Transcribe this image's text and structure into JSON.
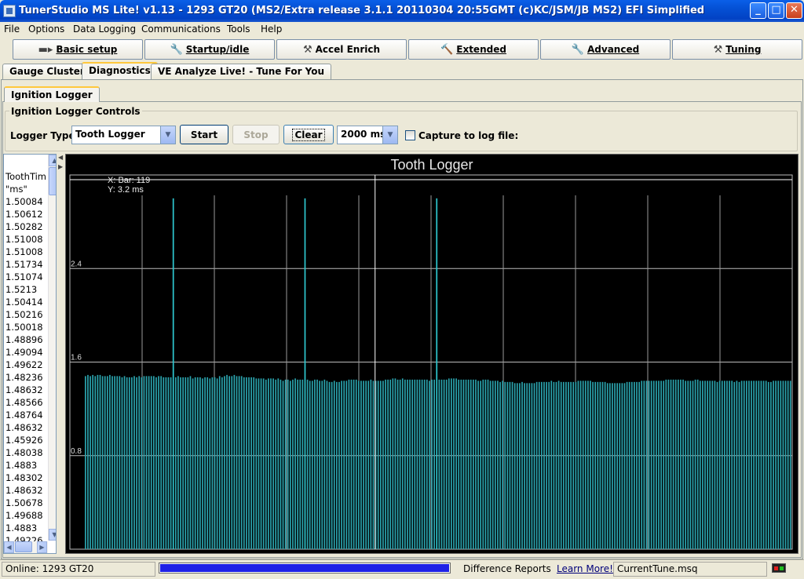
{
  "window": {
    "title": "TunerStudio MS Lite! v1.13 - 1293 GT20 (MS2/Extra release 3.1.1 20110304 20:55GMT (c)KC/JSM/JB MS2) EFI Simplified",
    "minimize_glyph": "_",
    "maximize_glyph": "□",
    "close_glyph": "✕"
  },
  "menu": [
    "File",
    "Options",
    "Data Logging",
    "Communications",
    "Tools",
    "Help"
  ],
  "toolbar": {
    "buttons": [
      {
        "label": "Basic setup",
        "icon": "engine-icon",
        "glyph": "▬▸"
      },
      {
        "label": "Startup/idle",
        "icon": "wrench-icon",
        "glyph": "🔧"
      },
      {
        "label": "Accel Enrich",
        "icon": "tools-icon",
        "glyph": "⚒"
      },
      {
        "label": "Extended",
        "icon": "hammer-icon",
        "glyph": "🔨"
      },
      {
        "label": "Advanced",
        "icon": "wrench-icon",
        "glyph": "🔧"
      },
      {
        "label": "Tuning",
        "icon": "tools-icon",
        "glyph": "⚒"
      }
    ]
  },
  "tabs": [
    "Gauge Cluster",
    "Diagnostics",
    "VE Analyze Live! - Tune For You"
  ],
  "active_tab": "Diagnostics",
  "subtab": "Ignition Logger",
  "controls": {
    "group_title": "Ignition Logger Controls",
    "logger_type_label": "Logger Type:",
    "logger_type_value": "Tooth Logger",
    "start_label": "Start",
    "stop_label": "Stop",
    "clear_label": "Clear",
    "duration_value": "2000 ms",
    "capture_label": "Capture to log file:",
    "capture_checked": false
  },
  "list": {
    "lines": [
      "ToothTim",
      "\"ms\"",
      "1.50084",
      "1.50612",
      "1.50282",
      "1.51008",
      "1.51008",
      "1.51734",
      "1.51074",
      "1.5213",
      "1.50414",
      "1.50216",
      "1.50018",
      "1.48896",
      "1.49094",
      "1.49622",
      "1.48236",
      "1.48632",
      "1.48566",
      "1.48764",
      "1.48632",
      "1.45926",
      "1.48038",
      "1.4883",
      "1.48302",
      "1.48632",
      "1.50678",
      "1.49688",
      "1.4883",
      "1.49226"
    ]
  },
  "chart_data": {
    "type": "bar",
    "title": "Tooth Logger",
    "cursor_readout": {
      "x": "X: Bar: 119",
      "y": "Y: 3.2 ms"
    },
    "y_ticks": [
      "2.4",
      "1.6",
      "0.8"
    ],
    "ylim": [
      0,
      3.2
    ],
    "bar_color": "#2AA3AD",
    "missing_tooth_color": "#2EC7CF",
    "cursor_bar": 119,
    "missing_tooth_value": 3.0,
    "values": [
      1.48,
      1.49,
      1.48,
      1.49,
      1.48,
      1.49,
      1.49,
      1.48,
      1.48,
      1.48,
      1.49,
      1.48,
      1.48,
      1.48,
      1.48,
      1.47,
      1.48,
      1.47,
      1.47,
      1.47,
      1.48,
      1.47,
      1.48,
      1.47,
      1.48,
      1.48,
      1.48,
      1.48,
      1.48,
      1.47,
      1.48,
      1.48,
      1.47,
      1.47,
      1.47,
      1.47,
      1.47,
      1.48,
      1.47,
      1.47,
      1.47,
      1.47,
      1.48,
      1.46,
      1.47,
      1.47,
      1.47,
      1.46,
      1.47,
      1.47,
      1.46,
      1.47,
      1.47,
      1.46,
      1.48,
      1.47,
      1.48,
      1.49,
      1.48,
      1.48,
      1.49,
      1.48,
      1.48,
      1.48,
      1.47,
      1.47,
      1.47,
      1.47,
      1.47,
      1.46,
      1.46,
      1.46,
      1.46,
      1.45,
      1.46,
      1.46,
      1.46,
      1.45,
      1.46,
      1.45,
      1.44,
      1.45,
      1.45,
      1.44,
      1.45,
      1.46,
      1.45,
      1.45,
      1.45,
      1.45,
      1.44,
      1.44,
      1.45,
      1.45,
      1.44,
      1.44,
      1.45,
      1.44,
      1.43,
      1.43,
      1.44,
      1.43,
      1.43,
      1.44,
      1.44,
      1.44,
      1.45,
      1.45,
      1.45,
      1.45,
      1.44,
      1.44,
      1.44,
      1.44,
      1.44,
      1.45,
      1.44,
      1.44,
      1.44,
      1.44,
      1.44,
      1.45,
      1.45,
      1.45,
      1.46,
      1.46,
      1.45,
      1.45,
      1.46,
      1.45,
      1.45,
      1.45,
      1.45,
      1.45,
      1.45,
      1.45,
      1.45,
      1.45,
      1.45,
      1.44,
      1.45,
      1.45,
      1.45,
      1.45,
      1.45,
      1.45,
      1.46,
      1.46,
      1.46,
      1.46,
      1.45,
      1.45,
      1.45,
      1.45,
      1.45,
      1.45,
      1.45,
      1.45,
      1.44,
      1.44,
      1.45,
      1.45,
      1.45,
      1.44,
      1.44,
      1.44,
      1.44,
      1.43,
      1.44,
      1.43,
      1.43,
      1.43,
      1.43,
      1.42,
      1.42,
      1.42,
      1.43,
      1.42,
      1.42,
      1.42,
      1.42,
      1.42,
      1.43,
      1.43,
      1.43,
      1.43,
      1.43,
      1.43,
      1.44,
      1.43,
      1.43,
      1.44,
      1.43,
      1.43,
      1.43,
      1.43,
      1.43,
      1.43,
      1.43,
      1.44,
      1.44,
      1.44,
      1.44,
      1.44,
      1.44,
      1.43,
      1.43,
      1.43,
      1.43,
      1.43,
      1.43,
      1.42,
      1.42,
      1.42,
      1.42,
      1.42,
      1.42,
      1.42,
      1.42,
      1.43,
      1.43,
      1.43,
      1.43,
      1.43,
      1.43,
      1.44,
      1.44,
      1.44,
      1.44,
      1.44,
      1.44,
      1.44,
      1.44,
      1.44,
      1.44,
      1.45,
      1.45,
      1.45,
      1.45,
      1.45,
      1.45,
      1.45,
      1.45,
      1.44,
      1.44,
      1.44,
      1.44,
      1.45,
      1.45,
      1.44,
      1.44,
      1.44,
      1.44,
      1.44,
      1.44,
      1.44,
      1.43,
      1.44,
      1.44,
      1.44,
      1.44,
      1.44,
      1.44,
      1.43,
      1.44,
      1.43,
      1.44,
      1.44,
      1.44,
      1.44,
      1.44,
      1.44,
      1.44,
      1.44,
      1.44,
      1.44,
      1.44,
      1.43,
      1.43,
      1.44,
      1.44,
      1.44,
      1.44,
      1.44,
      1.44,
      1.44,
      1.44
    ],
    "missing_tooth_positions": [
      36,
      90,
      144
    ],
    "x_gridlines": 9
  },
  "status": {
    "connection": "Online: 1293 GT20",
    "progress_fraction": 1.0,
    "difference_reports": "Difference Reports",
    "learn_more": "Learn More!",
    "tune_file": "CurrentTune.msq"
  }
}
